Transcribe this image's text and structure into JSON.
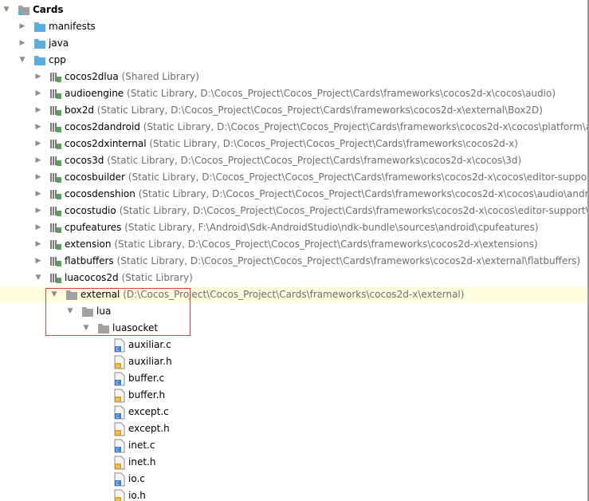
{
  "tree": {
    "project": {
      "name": "Cards"
    },
    "folders": [
      {
        "name": "manifests"
      },
      {
        "name": "java"
      },
      {
        "name": "cpp"
      }
    ],
    "libraries": [
      {
        "name": "cocos2dlua",
        "meta": "(Shared Library)"
      },
      {
        "name": "audioengine",
        "meta": "(Static Library, D:\\Cocos_Project\\Cocos_Project\\Cards\\frameworks\\cocos2d-x\\cocos\\audio)"
      },
      {
        "name": "box2d",
        "meta": "(Static Library, D:\\Cocos_Project\\Cocos_Project\\Cards\\frameworks\\cocos2d-x\\external\\Box2D)"
      },
      {
        "name": "cocos2dandroid",
        "meta": "(Static Library, D:\\Cocos_Project\\Cocos_Project\\Cards\\frameworks\\cocos2d-x\\cocos\\platform\\android)"
      },
      {
        "name": "cocos2dxinternal",
        "meta": "(Static Library, D:\\Cocos_Project\\Cocos_Project\\Cards\\frameworks\\cocos2d-x)"
      },
      {
        "name": "cocos3d",
        "meta": "(Static Library, D:\\Cocos_Project\\Cocos_Project\\Cards\\frameworks\\cocos2d-x\\cocos\\3d)"
      },
      {
        "name": "cocosbuilder",
        "meta": "(Static Library, D:\\Cocos_Project\\Cocos_Project\\Cards\\frameworks\\cocos2d-x\\cocos\\editor-support\\cocosbuilder)"
      },
      {
        "name": "cocosdenshion",
        "meta": "(Static Library, D:\\Cocos_Project\\Cocos_Project\\Cards\\frameworks\\cocos2d-x\\cocos\\audio\\android)"
      },
      {
        "name": "cocostudio",
        "meta": "(Static Library, D:\\Cocos_Project\\Cocos_Project\\Cards\\frameworks\\cocos2d-x\\cocos\\editor-support\\cocostudio)"
      },
      {
        "name": "cpufeatures",
        "meta": "(Static Library, F:\\Android\\Sdk-AndroidStudio\\ndk-bundle\\sources\\android\\cpufeatures)"
      },
      {
        "name": "extension",
        "meta": "(Static Library, D:\\Cocos_Project\\Cocos_Project\\Cards\\frameworks\\cocos2d-x\\extensions)"
      },
      {
        "name": "flatbuffers",
        "meta": "(Static Library, D:\\Cocos_Project\\Cocos_Project\\Cards\\frameworks\\cocos2d-x\\external\\flatbuffers)"
      },
      {
        "name": "luacocos2d",
        "meta": "(Static Library)"
      }
    ],
    "external": {
      "name": "external",
      "meta": "(D:\\Cocos_Project\\Cocos_Project\\Cards\\frameworks\\cocos2d-x\\external)"
    },
    "lua": {
      "name": "lua"
    },
    "luasocket": {
      "name": "luasocket"
    },
    "files": [
      {
        "name": "auxiliar.c",
        "type": "C"
      },
      {
        "name": "auxiliar.h",
        "type": "H"
      },
      {
        "name": "buffer.c",
        "type": "C"
      },
      {
        "name": "buffer.h",
        "type": "H"
      },
      {
        "name": "except.c",
        "type": "C"
      },
      {
        "name": "except.h",
        "type": "H"
      },
      {
        "name": "inet.c",
        "type": "C"
      },
      {
        "name": "inet.h",
        "type": "H"
      },
      {
        "name": "io.c",
        "type": "C"
      },
      {
        "name": "io.h",
        "type": "H"
      }
    ]
  },
  "colors": {
    "folder_blue": "#5aaee0",
    "folder_gray": "#a0a0a0",
    "highlight_row": "#fffdde",
    "selection_border": "#c8464b",
    "c_badge": "#3d7fcc",
    "h_badge": "#e0a21e"
  }
}
